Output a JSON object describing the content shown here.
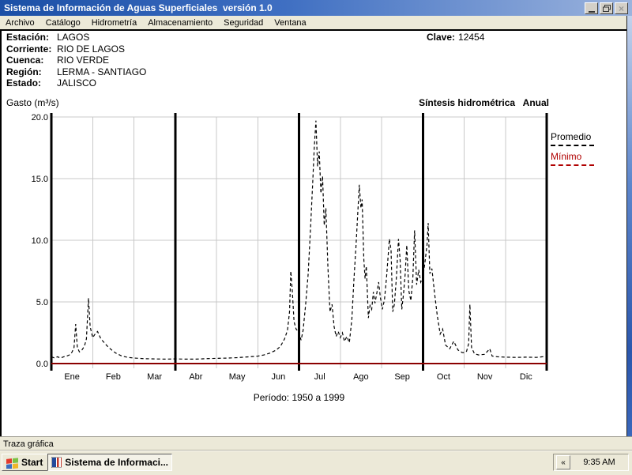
{
  "window": {
    "title": "Sistema de Información de Aguas Superficiales  versión 1.0",
    "controls": {
      "close_glyph": "×"
    }
  },
  "menu": {
    "items": [
      "Archivo",
      "Catálogo",
      "Hidrometría",
      "Almacenamiento",
      "Seguridad",
      "Ventana"
    ]
  },
  "station": {
    "fields": [
      {
        "label": "Estación:",
        "value": "LAGOS"
      },
      {
        "label": "Corriente:",
        "value": "RIO DE LAGOS"
      },
      {
        "label": "Cuenca:",
        "value": "RIO VERDE"
      },
      {
        "label": "Región:",
        "value": "LERMA - SANTIAGO"
      },
      {
        "label": "Estado:",
        "value": "JALISCO"
      }
    ],
    "clave_label": "Clave:",
    "clave_value": "12454"
  },
  "chart_data": {
    "type": "line",
    "title": "Síntesis hidrométrica   Anual",
    "ylabel": "Gasto (m³/s)",
    "xlabel": "",
    "caption": "Período:  1950 a 1999",
    "ylim": [
      0,
      20
    ],
    "x_range_months": [
      0,
      12
    ],
    "y_ticks": [
      0.0,
      5.0,
      10.0,
      15.0,
      20.0
    ],
    "months": [
      "Ene",
      "Feb",
      "Mar",
      "Abr",
      "May",
      "Jun",
      "Jul",
      "Ago",
      "Sep",
      "Oct",
      "Nov",
      "Dic"
    ],
    "grid": true,
    "grid_color": "#c8c8c8",
    "vlines_thin": [
      1,
      2,
      4,
      5,
      7,
      8,
      10,
      11
    ],
    "vlines_thick": [
      0,
      3,
      6,
      9,
      12
    ],
    "legend_position": "right",
    "legend": [
      {
        "name": "Promedio",
        "style": "dashed",
        "color": "#000000"
      },
      {
        "name": "Mínimo",
        "style": "solid",
        "color": "#8b0000"
      }
    ],
    "series": [
      {
        "name": "Promedio",
        "color": "#000000",
        "dash": "4 3",
        "points": [
          [
            0.0,
            0.55
          ],
          [
            0.08,
            0.45
          ],
          [
            0.15,
            0.55
          ],
          [
            0.22,
            0.45
          ],
          [
            0.3,
            0.55
          ],
          [
            0.38,
            0.62
          ],
          [
            0.45,
            0.72
          ],
          [
            0.5,
            0.92
          ],
          [
            0.55,
            1.3
          ],
          [
            0.59,
            3.2
          ],
          [
            0.63,
            1.3
          ],
          [
            0.68,
            0.95
          ],
          [
            0.74,
            1.1
          ],
          [
            0.8,
            1.4
          ],
          [
            0.85,
            2.0
          ],
          [
            0.9,
            5.3
          ],
          [
            0.94,
            3.0
          ],
          [
            1.0,
            2.1
          ],
          [
            1.06,
            2.4
          ],
          [
            1.12,
            2.6
          ],
          [
            1.2,
            2.0
          ],
          [
            1.28,
            1.7
          ],
          [
            1.36,
            1.4
          ],
          [
            1.46,
            1.1
          ],
          [
            1.56,
            0.85
          ],
          [
            1.7,
            0.62
          ],
          [
            1.85,
            0.5
          ],
          [
            2.0,
            0.45
          ],
          [
            2.25,
            0.4
          ],
          [
            2.5,
            0.38
          ],
          [
            2.75,
            0.36
          ],
          [
            3.0,
            0.38
          ],
          [
            3.25,
            0.36
          ],
          [
            3.5,
            0.36
          ],
          [
            3.75,
            0.4
          ],
          [
            4.0,
            0.42
          ],
          [
            4.25,
            0.44
          ],
          [
            4.5,
            0.48
          ],
          [
            4.75,
            0.54
          ],
          [
            5.0,
            0.6
          ],
          [
            5.15,
            0.7
          ],
          [
            5.3,
            0.85
          ],
          [
            5.45,
            1.1
          ],
          [
            5.55,
            1.4
          ],
          [
            5.65,
            2.0
          ],
          [
            5.72,
            2.7
          ],
          [
            5.77,
            4.2
          ],
          [
            5.8,
            7.5
          ],
          [
            5.84,
            5.8
          ],
          [
            5.88,
            3.4
          ],
          [
            5.93,
            2.8
          ],
          [
            6.0,
            2.5
          ],
          [
            6.05,
            1.9
          ],
          [
            6.1,
            2.7
          ],
          [
            6.16,
            4.8
          ],
          [
            6.22,
            7.2
          ],
          [
            6.28,
            11.0
          ],
          [
            6.33,
            14.5
          ],
          [
            6.37,
            17.5
          ],
          [
            6.41,
            19.7
          ],
          [
            6.45,
            16.0
          ],
          [
            6.49,
            17.2
          ],
          [
            6.53,
            13.8
          ],
          [
            6.57,
            15.2
          ],
          [
            6.61,
            11.2
          ],
          [
            6.65,
            12.6
          ],
          [
            6.7,
            7.8
          ],
          [
            6.75,
            4.2
          ],
          [
            6.8,
            4.8
          ],
          [
            6.85,
            3.0
          ],
          [
            6.9,
            2.2
          ],
          [
            6.95,
            2.6
          ],
          [
            7.0,
            2.1
          ],
          [
            7.05,
            2.5
          ],
          [
            7.1,
            1.8
          ],
          [
            7.16,
            2.2
          ],
          [
            7.22,
            1.7
          ],
          [
            7.28,
            3.6
          ],
          [
            7.33,
            6.8
          ],
          [
            7.38,
            9.5
          ],
          [
            7.42,
            12.0
          ],
          [
            7.46,
            14.5
          ],
          [
            7.5,
            12.6
          ],
          [
            7.53,
            13.3
          ],
          [
            7.57,
            8.5
          ],
          [
            7.6,
            6.9
          ],
          [
            7.63,
            7.9
          ],
          [
            7.68,
            3.7
          ],
          [
            7.72,
            4.7
          ],
          [
            7.76,
            4.4
          ],
          [
            7.8,
            5.8
          ],
          [
            7.84,
            4.9
          ],
          [
            7.88,
            5.6
          ],
          [
            7.93,
            6.6
          ],
          [
            7.97,
            5.4
          ],
          [
            8.02,
            4.4
          ],
          [
            8.07,
            5.2
          ],
          [
            8.12,
            7.0
          ],
          [
            8.19,
            10.1
          ],
          [
            8.23,
            9.2
          ],
          [
            8.27,
            4.2
          ],
          [
            8.31,
            4.8
          ],
          [
            8.36,
            7.0
          ],
          [
            8.41,
            10.1
          ],
          [
            8.45,
            8.4
          ],
          [
            8.49,
            4.4
          ],
          [
            8.53,
            5.6
          ],
          [
            8.57,
            7.2
          ],
          [
            8.61,
            9.6
          ],
          [
            8.66,
            5.9
          ],
          [
            8.71,
            5.1
          ],
          [
            8.76,
            7.1
          ],
          [
            8.8,
            10.8
          ],
          [
            8.85,
            6.4
          ],
          [
            8.9,
            7.6
          ],
          [
            8.95,
            6.6
          ],
          [
            9.0,
            7.0
          ],
          [
            9.05,
            8.2
          ],
          [
            9.1,
            9.6
          ],
          [
            9.13,
            11.4
          ],
          [
            9.17,
            7.3
          ],
          [
            9.22,
            7.7
          ],
          [
            9.28,
            5.8
          ],
          [
            9.35,
            3.9
          ],
          [
            9.42,
            2.4
          ],
          [
            9.48,
            2.8
          ],
          [
            9.55,
            1.5
          ],
          [
            9.65,
            1.2
          ],
          [
            9.75,
            1.8
          ],
          [
            9.85,
            1.1
          ],
          [
            9.95,
            0.9
          ],
          [
            10.0,
            0.88
          ],
          [
            10.06,
            1.0
          ],
          [
            10.11,
            1.6
          ],
          [
            10.14,
            4.8
          ],
          [
            10.18,
            1.3
          ],
          [
            10.25,
            0.8
          ],
          [
            10.35,
            0.7
          ],
          [
            10.5,
            0.75
          ],
          [
            10.62,
            1.2
          ],
          [
            10.68,
            0.6
          ],
          [
            10.8,
            0.55
          ],
          [
            11.0,
            0.52
          ],
          [
            11.25,
            0.5
          ],
          [
            11.5,
            0.52
          ],
          [
            11.75,
            0.5
          ],
          [
            11.9,
            0.55
          ],
          [
            12.0,
            0.6
          ]
        ]
      },
      {
        "name": "Mínimo",
        "color": "#8b0000",
        "dash": "",
        "points": [
          [
            0,
            0
          ],
          [
            12,
            0
          ]
        ]
      }
    ]
  },
  "statusbar": {
    "text": "Traza gráfica"
  },
  "taskbar": {
    "start_label": "Start",
    "task_label": "Sistema de Informaci...",
    "tray_chevron": "«",
    "clock": "9:35 AM"
  }
}
